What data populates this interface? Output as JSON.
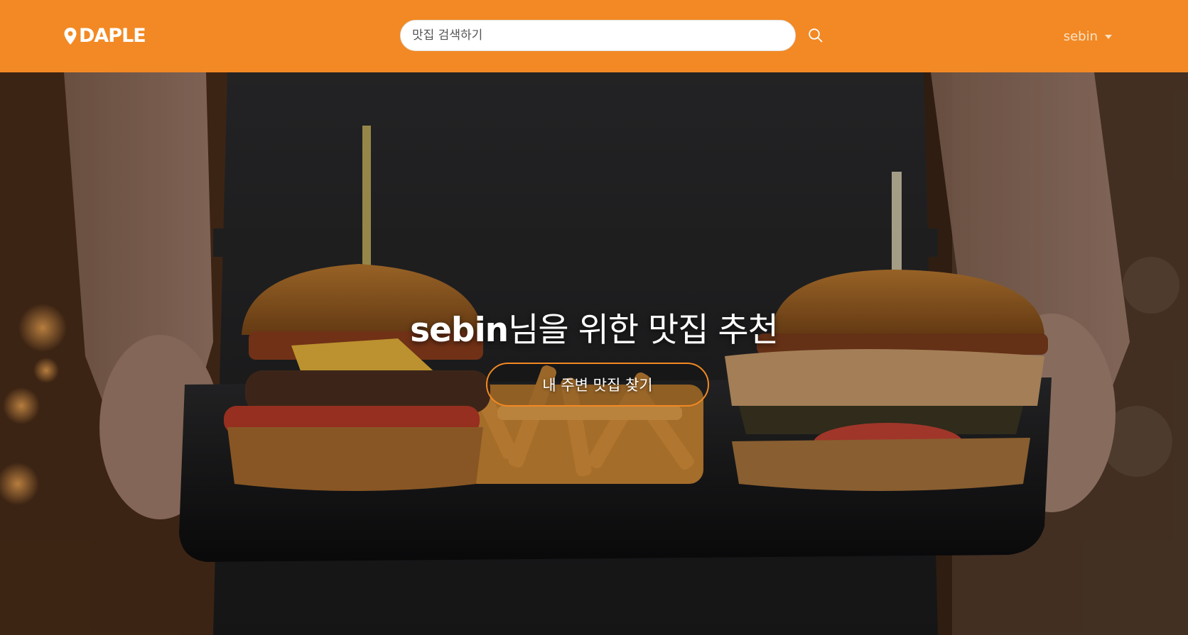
{
  "header": {
    "logo_text": "DAPLE",
    "search": {
      "placeholder": "맛집 검색하기",
      "value": ""
    },
    "search_icon": "search-icon",
    "user": {
      "name": "sebin",
      "dropdown_icon": "caret-down-icon"
    },
    "colors": {
      "brand": "#f28924",
      "search_bg": "#ffffff",
      "user_text": "#fbe2c8"
    }
  },
  "hero": {
    "title_user": "sebin",
    "title_rest": "님을 위한 맛집 추천",
    "cta_label": "내 주변 맛집 찾기",
    "background": "burger-tray-photo",
    "colors": {
      "cta_border": "#f28924",
      "title": "#ffffff"
    }
  }
}
